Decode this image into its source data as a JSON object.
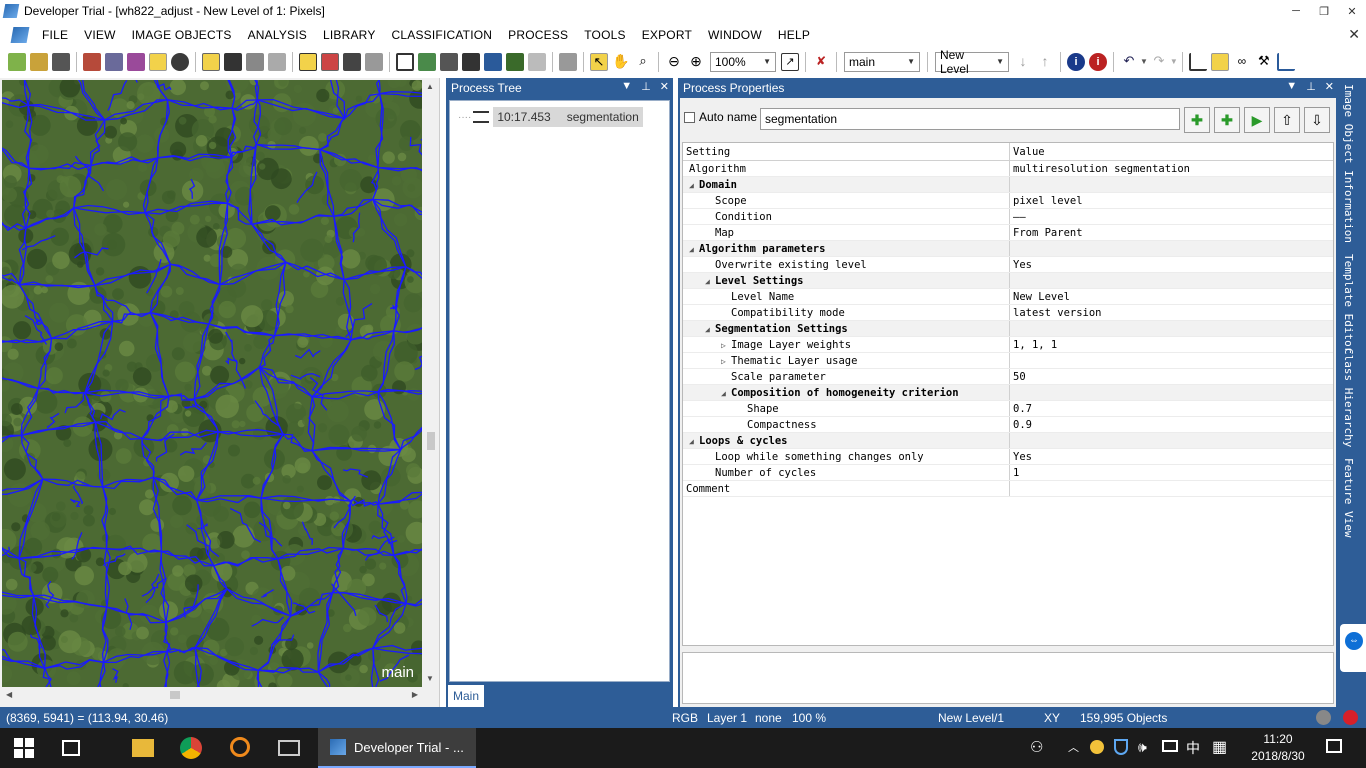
{
  "window": {
    "title": "Developer Trial - [wh822_adjust - New Level of 1: Pixels]",
    "minimize": "─",
    "restore": "❐",
    "close": "✕"
  },
  "menu": {
    "items": [
      "FILE",
      "VIEW",
      "IMAGE OBJECTS",
      "ANALYSIS",
      "LIBRARY",
      "CLASSIFICATION",
      "PROCESS",
      "TOOLS",
      "EXPORT",
      "WINDOW",
      "HELP"
    ],
    "close": "✕"
  },
  "toolbar": {
    "zoom": "100%",
    "map": "main",
    "level": "New Level"
  },
  "image_view": {
    "map_label": "main"
  },
  "process_tree": {
    "title": "Process Tree",
    "node_time": "10:17.453",
    "node_name": "segmentation",
    "tab": "Main"
  },
  "process_properties": {
    "title": "Process Properties",
    "auto_name_label": "Auto name",
    "name_value": "segmentation",
    "header_setting": "Setting",
    "header_value": "Value",
    "rows": [
      {
        "indent": 0,
        "tri": "",
        "label": "Algorithm",
        "value": "multiresolution segmentation",
        "cat": false
      },
      {
        "indent": 0,
        "tri": "◢",
        "label": "Domain",
        "value": "",
        "cat": true
      },
      {
        "indent": 1,
        "tri": "",
        "label": "Scope",
        "value": "pixel level",
        "cat": false
      },
      {
        "indent": 1,
        "tri": "",
        "label": "Condition",
        "value": "——",
        "cat": false
      },
      {
        "indent": 1,
        "tri": "",
        "label": "Map",
        "value": "From Parent",
        "cat": false
      },
      {
        "indent": 0,
        "tri": "◢",
        "label": "Algorithm parameters",
        "value": "",
        "cat": true
      },
      {
        "indent": 1,
        "tri": "",
        "label": "Overwrite existing level",
        "value": "Yes",
        "cat": false
      },
      {
        "indent": 1,
        "tri": "◢",
        "label": "Level Settings",
        "value": "",
        "cat": true
      },
      {
        "indent": 2,
        "tri": "",
        "label": "Level Name",
        "value": "New Level",
        "cat": false
      },
      {
        "indent": 2,
        "tri": "",
        "label": "Compatibility mode",
        "value": "latest version",
        "cat": false
      },
      {
        "indent": 1,
        "tri": "◢",
        "label": "Segmentation Settings",
        "value": "",
        "cat": true
      },
      {
        "indent": 2,
        "tri": "▷",
        "label": "Image Layer weights",
        "value": "1, 1, 1",
        "cat": false
      },
      {
        "indent": 2,
        "tri": "▷",
        "label": "Thematic Layer usage",
        "value": "",
        "cat": false
      },
      {
        "indent": 2,
        "tri": "",
        "label": "Scale parameter",
        "value": "50",
        "cat": false
      },
      {
        "indent": 2,
        "tri": "◢",
        "label": "Composition of homogeneity criterion",
        "value": "",
        "cat": true
      },
      {
        "indent": 3,
        "tri": "",
        "label": "Shape",
        "value": "0.7",
        "cat": false
      },
      {
        "indent": 3,
        "tri": "",
        "label": "Compactness",
        "value": "0.9",
        "cat": false
      },
      {
        "indent": 0,
        "tri": "◢",
        "label": "Loops & cycles",
        "value": "",
        "cat": true
      },
      {
        "indent": 1,
        "tri": "",
        "label": "Loop while something changes only",
        "value": "Yes",
        "cat": false
      },
      {
        "indent": 1,
        "tri": "",
        "label": "Number of cycles",
        "value": "1",
        "cat": false
      },
      {
        "indent": -1,
        "tri": "",
        "label": "Comment",
        "value": "",
        "cat": false
      }
    ]
  },
  "side_tabs": [
    "Image Object Information",
    "Template Editor",
    "Class Hierarchy",
    "Feature View"
  ],
  "status": {
    "coords": "(8369, 5941) = (113.94, 30.46)",
    "mode": "RGB",
    "layer": "Layer 1",
    "none": "none",
    "zoom": "100 %",
    "level": "New Level/1",
    "xy": "XY",
    "objects": "159,995 Objects"
  },
  "taskbar": {
    "active_app": "Developer Trial - ...",
    "time": "11:20",
    "date": "2018/8/30",
    "ime": "中"
  }
}
